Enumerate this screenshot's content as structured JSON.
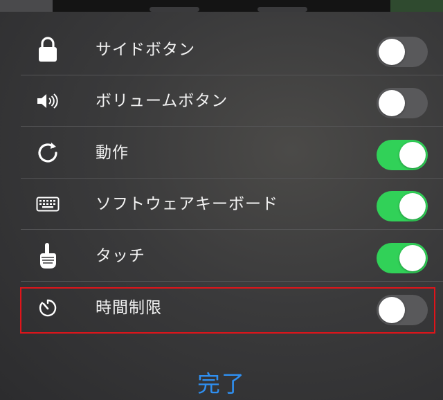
{
  "rows": [
    {
      "label": "サイドボタン",
      "icon": "lock-icon",
      "on": false
    },
    {
      "label": "ボリュームボタン",
      "icon": "speaker-volume-icon",
      "on": false
    },
    {
      "label": "動作",
      "icon": "rotate-icon",
      "on": true
    },
    {
      "label": "ソフトウェアキーボード",
      "icon": "keyboard-icon",
      "on": true
    },
    {
      "label": "タッチ",
      "icon": "pointing-hand-icon",
      "on": true
    },
    {
      "label": "時間制限",
      "icon": "timer-icon",
      "on": false
    }
  ],
  "done_label": "完了",
  "colors": {
    "toggle_on": "#31d158",
    "toggle_off": "#59595b",
    "accent_blue": "#2f8ff0",
    "highlight_red": "#e0141a"
  }
}
